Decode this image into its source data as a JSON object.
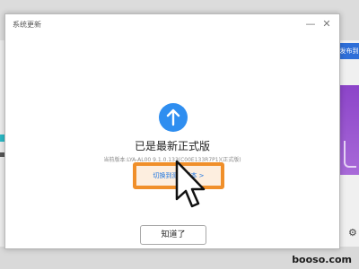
{
  "dialog": {
    "title": "系统更新",
    "minimize_icon": "minimize-icon",
    "close_icon": "close-icon",
    "status_title": "已是最新正式版",
    "current_version": "当前版本:LYA-AL00 9.1.0.133(C00E133R7P1)(正式版)",
    "switch_link": "切换到测试版本 >",
    "ok_button": "知道了"
  },
  "background": {
    "right_button": "发布到",
    "gear_icon": "gear-icon"
  },
  "watermark": "booso.com",
  "colors": {
    "accent": "#1c74e0",
    "icon_blue": "#2f8ef0",
    "highlight": "#f08f2a"
  }
}
